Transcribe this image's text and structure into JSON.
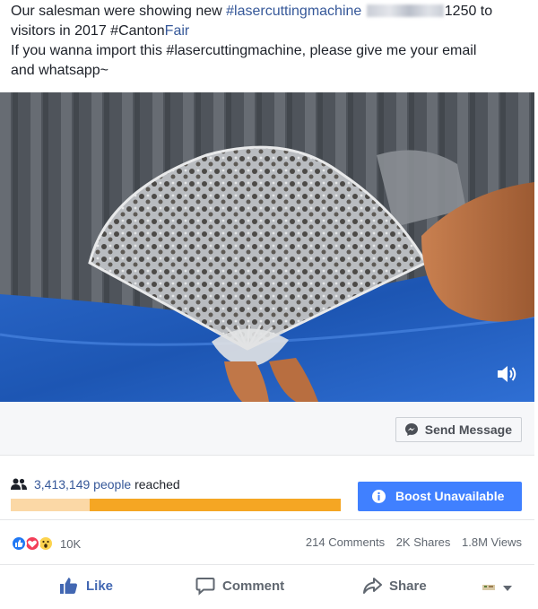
{
  "post": {
    "line1_prefix": "Our salesman were showing new ",
    "line1_hashtag": "#lasercuttingmachine",
    "line1_suffix": "1250 to",
    "line2_prefix": "visitors in 2017 ",
    "line2_hashtag_a": "#Canton",
    "line2_hashtag_b": "Fair",
    "line3": "If you wanna import this #lasercuttingmachine, please give me your email",
    "line4": "and whatsapp~"
  },
  "video": {
    "volume_icon": "speaker-icon"
  },
  "send_message": {
    "label": "Send Message",
    "icon": "messenger-icon"
  },
  "reach": {
    "count": "3,413,149 people",
    "suffix": " reached",
    "progress_percent": 100,
    "colors": {
      "fill": "#f5a623",
      "light": "#fbd8a6"
    }
  },
  "boost": {
    "label": "Boost Unavailable",
    "icon": "info-icon",
    "color": "#4080ff"
  },
  "stats": {
    "reactions": [
      "like-icon",
      "love-icon",
      "wow-icon"
    ],
    "reaction_count": "10K",
    "comments": "214 Comments",
    "shares": "2K Shares",
    "views": "1.8M Views"
  },
  "actions": {
    "like": "Like",
    "comment": "Comment",
    "share": "Share"
  }
}
